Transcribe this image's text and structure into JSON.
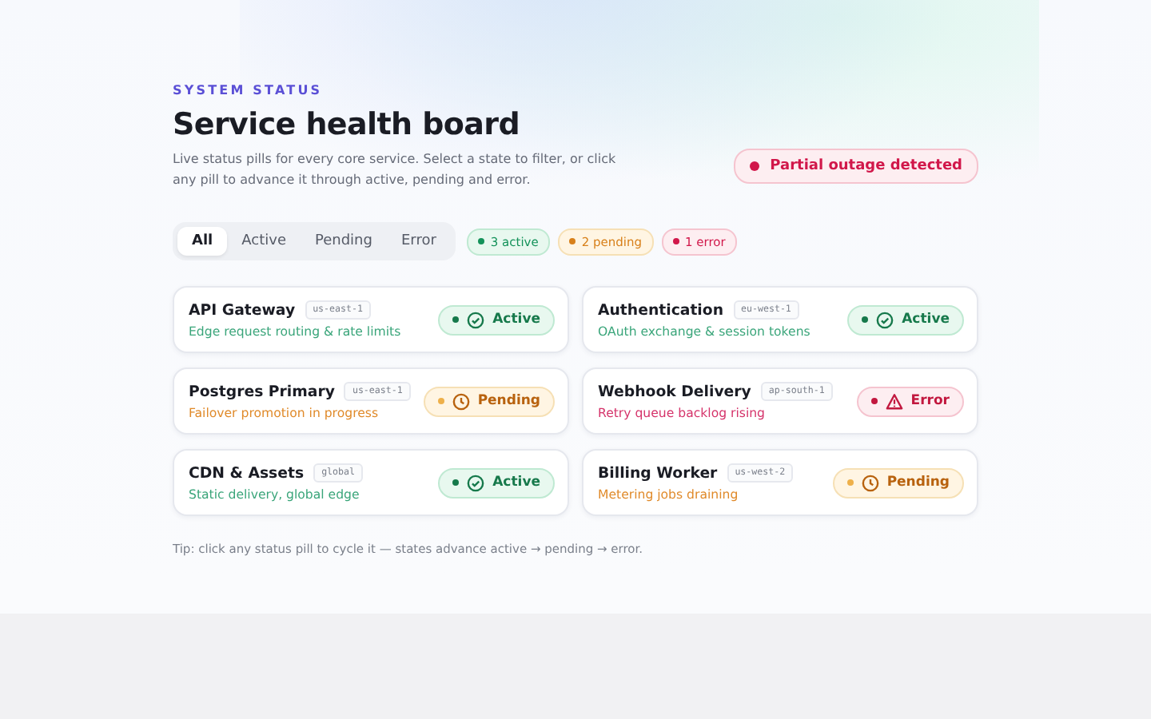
{
  "header": {
    "eyebrow": "SYSTEM STATUS",
    "title": "Service health board",
    "description": "Live status pills for every core service. Select a state to filter, or click any pill to advance it through active, pending and error.",
    "alert": {
      "kind": "error",
      "label": "Partial outage detected"
    }
  },
  "filters": [
    {
      "label": "All",
      "selected": true
    },
    {
      "label": "Active",
      "selected": false
    },
    {
      "label": "Pending",
      "selected": false
    },
    {
      "label": "Error",
      "selected": false
    }
  ],
  "counts": [
    {
      "kind": "active",
      "label": "3 active"
    },
    {
      "kind": "pending",
      "label": "2 pending"
    },
    {
      "kind": "error",
      "label": "1 error"
    }
  ],
  "services": [
    {
      "name": "API Gateway",
      "region": "us-east-1",
      "detail": "Edge request routing & rate limits",
      "kind": "active",
      "status": "Active"
    },
    {
      "name": "Authentication",
      "region": "eu-west-1",
      "detail": "OAuth exchange & session tokens",
      "kind": "active",
      "status": "Active"
    },
    {
      "name": "Postgres Primary",
      "region": "us-east-1",
      "detail": "Failover promotion in progress",
      "kind": "pending",
      "status": "Pending"
    },
    {
      "name": "Webhook Delivery",
      "region": "ap-south-1",
      "detail": "Retry queue backlog rising",
      "kind": "error",
      "status": "Error"
    },
    {
      "name": "CDN & Assets",
      "region": "global",
      "detail": "Static delivery, global edge",
      "kind": "active",
      "status": "Active"
    },
    {
      "name": "Billing Worker",
      "region": "us-west-2",
      "detail": "Metering jobs draining",
      "kind": "pending",
      "status": "Pending"
    }
  ],
  "tip": "Tip: click any status pill to cycle it — states advance active → pending → error."
}
